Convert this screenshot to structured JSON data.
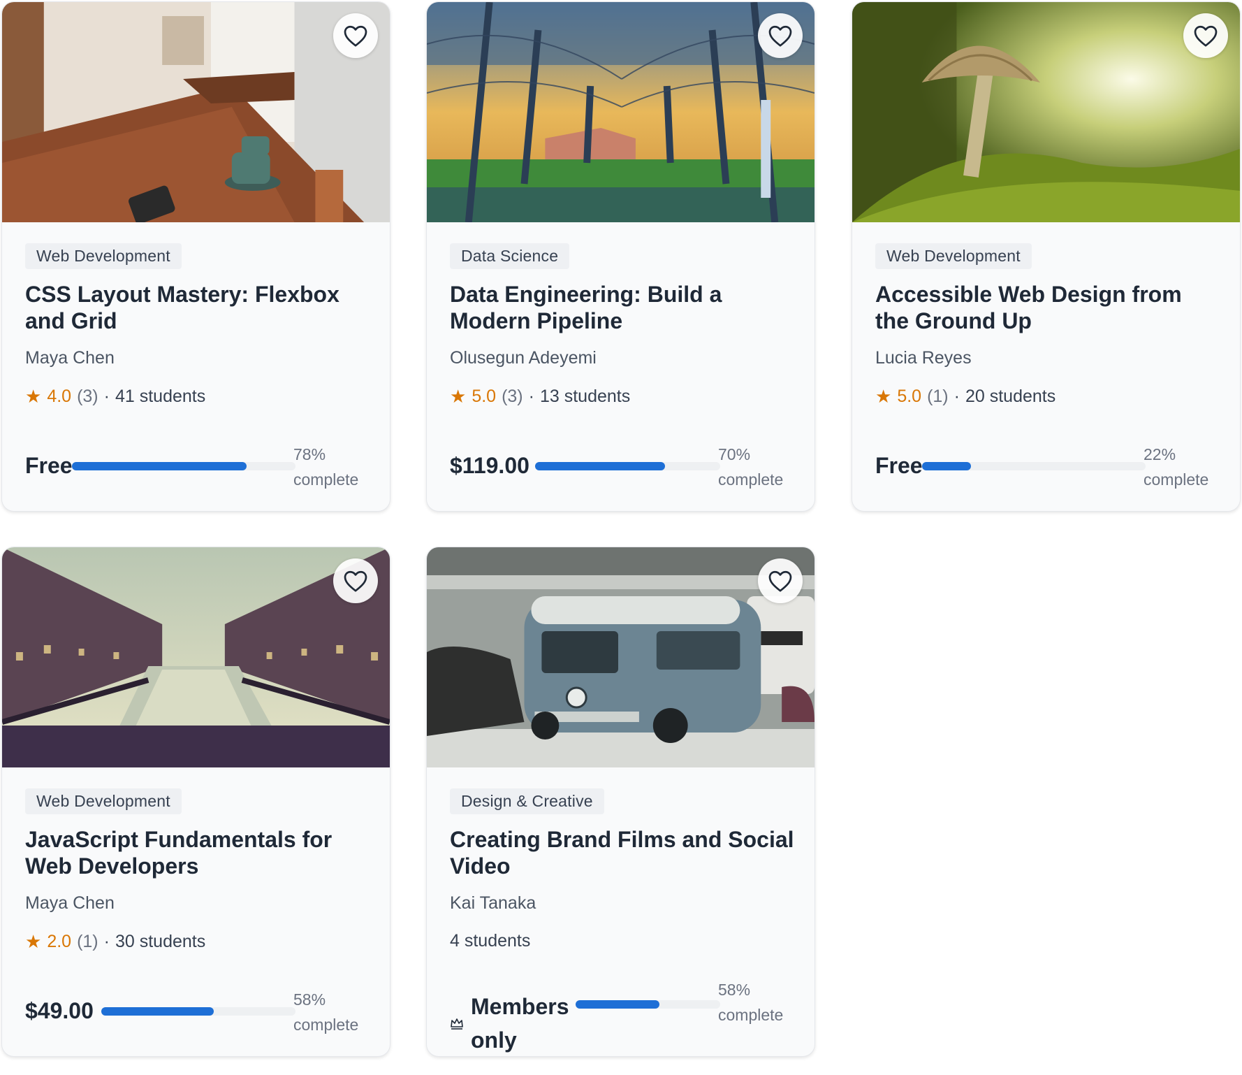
{
  "favorite_icon": "heart-outline-icon",
  "progress_color": "#1e6fd6",
  "rating_color": "#d97706",
  "courses": [
    {
      "image": "cafe-table-photo",
      "category": "Web Development",
      "title": "CSS Layout Mastery: Flexbox and Grid",
      "author": "Maya Chen",
      "rating": "4.0",
      "rating_count": "(3)",
      "students": "41 students",
      "price": "Free",
      "progress": 78,
      "progress_label": "78% complete"
    },
    {
      "image": "orchard-trees-photo",
      "category": "Data Science",
      "title": "Data Engineering: Build a Modern Pipeline",
      "author": "Olusegun Adeyemi",
      "rating": "5.0",
      "rating_count": "(3)",
      "students": "13 students",
      "price": "$119.00",
      "progress": 70,
      "progress_label": "70% complete"
    },
    {
      "image": "mushroom-moss-photo",
      "category": "Web Development",
      "title": "Accessible Web Design from the Ground Up",
      "author": "Lucia Reyes",
      "rating": "5.0",
      "rating_count": "(1)",
      "students": "20 students",
      "price": "Free",
      "progress": 22,
      "progress_label": "22% complete"
    },
    {
      "image": "canal-city-photo",
      "category": "Web Development",
      "title": "JavaScript Fundamentals for Web Developers",
      "author": "Maya Chen",
      "rating": "2.0",
      "rating_count": "(1)",
      "students": "30 students",
      "price": "$49.00",
      "progress": 58,
      "progress_label": "58% complete"
    },
    {
      "image": "vintage-van-photo",
      "category": "Design & Creative",
      "title": "Creating Brand Films and Social Video",
      "author": "Kai Tanaka",
      "rating": null,
      "rating_count": null,
      "students": "4 students",
      "price": "Members only",
      "price_icon": "crown-icon",
      "progress": 58,
      "progress_label": "58% complete"
    }
  ]
}
